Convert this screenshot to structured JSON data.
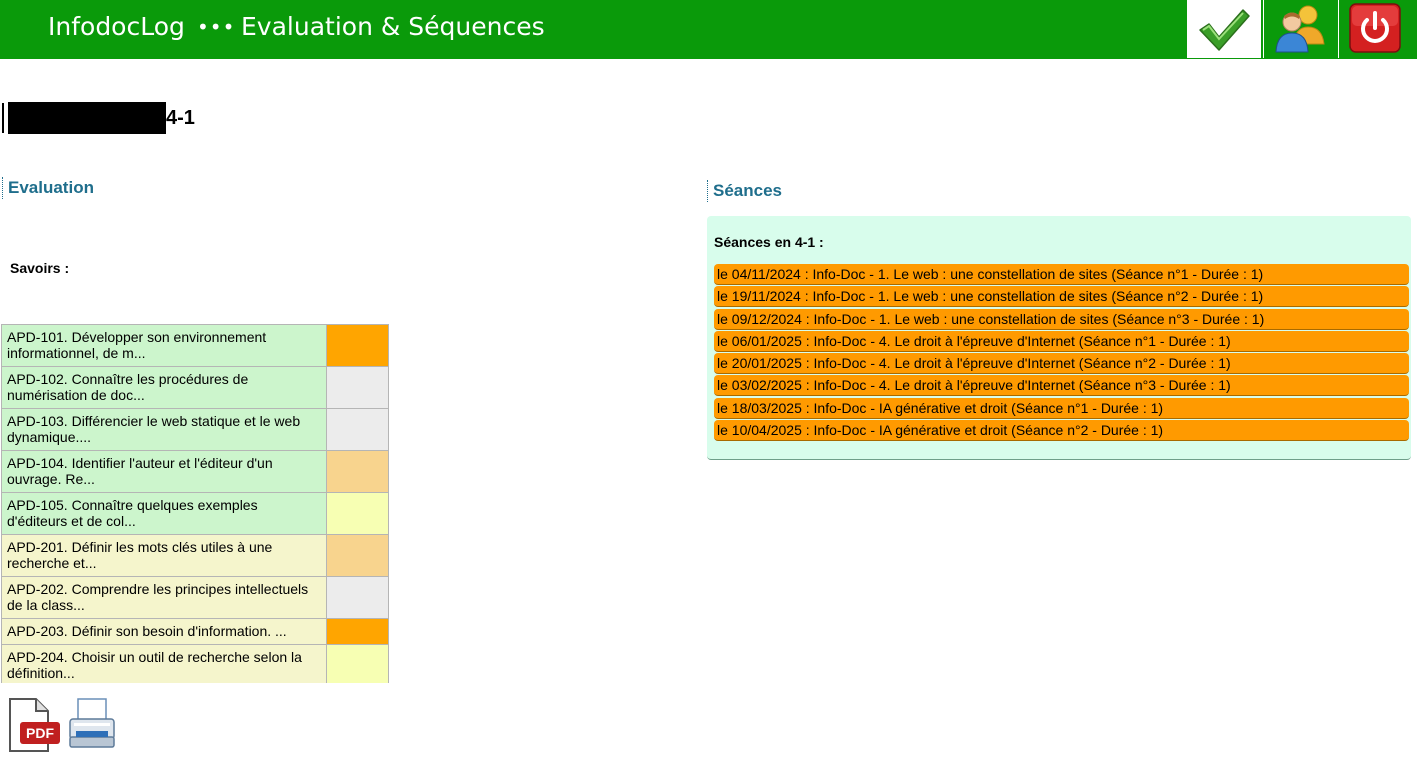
{
  "header": {
    "app_name": "InfodocLog",
    "separator": "•••",
    "page_name": "Evaluation & Séquences",
    "buttons": [
      "check-icon",
      "users-icon",
      "power-icon"
    ]
  },
  "class": {
    "name": "4-1"
  },
  "evaluation": {
    "title": "Evaluation",
    "savoirs_label": "Savoirs :",
    "skills": [
      {
        "label": "APD-101. Développer son environnement informationnel, de m...",
        "level_color": "#ffa500"
      },
      {
        "label": "APD-102. Connaître les procédures de numérisation de doc...",
        "level_color": "#ececec"
      },
      {
        "label": "APD-103. Différencier le web statique et le web dynamique....",
        "level_color": "#ececec"
      },
      {
        "label": "APD-104. Identifier l'auteur et l'éditeur d'un ouvrage. Re...",
        "level_color": "#f8d48e"
      },
      {
        "label": "APD-105. Connaître quelques exemples d'éditeurs et de col...",
        "level_color": "#f7ffb3"
      },
      {
        "label": "APD-201. Définir les mots clés utiles à une recherche et...",
        "level_color": "#f8d48e"
      },
      {
        "label": "APD-202. Comprendre les principes intellectuels de la class...",
        "level_color": "#ececec"
      },
      {
        "label": "APD-203. Définir son besoin d'information. ...",
        "level_color": "#ffa500"
      },
      {
        "label": "APD-204. Choisir un outil de recherche selon la définition...",
        "level_color": "#f7ffb3"
      }
    ],
    "row_colors": {
      "group_1": "#ccf5cc",
      "group_2": "#f5f5cc"
    }
  },
  "seances": {
    "title": "Séances",
    "heading": "Séances en 4-1 :",
    "items": [
      "le 04/11/2024 : Info-Doc - 1. Le web : une constellation de sites (Séance n°1 - Durée : 1)",
      "le 19/11/2024 : Info-Doc - 1. Le web : une constellation de sites (Séance n°2 - Durée : 1)",
      "le 09/12/2024 : Info-Doc - 1. Le web : une constellation de sites (Séance n°3 - Durée : 1)",
      "le 06/01/2025 : Info-Doc - 4. Le droit à l'épreuve d'Internet (Séance n°1 - Durée : 1)",
      "le 20/01/2025 : Info-Doc - 4. Le droit à l'épreuve d'Internet (Séance n°2 - Durée : 1)",
      "le 03/02/2025 : Info-Doc - 4. Le droit à l'épreuve d'Internet (Séance n°3 - Durée : 1)",
      "le 18/03/2025 : Info-Doc - IA générative et droit (Séance n°1 - Durée : 1)",
      "le 10/04/2025 : Info-Doc - IA générative et droit (Séance n°2 - Durée : 1)"
    ]
  },
  "export": {
    "pdf_text": "PDF",
    "icons": [
      "pdf-icon",
      "printer-icon"
    ]
  },
  "colors": {
    "header_bg": "#0a9a0a",
    "section_title": "#1f6e8c",
    "seance_bg": "#ff9a00",
    "seances_panel_bg": "#d8fdec"
  }
}
